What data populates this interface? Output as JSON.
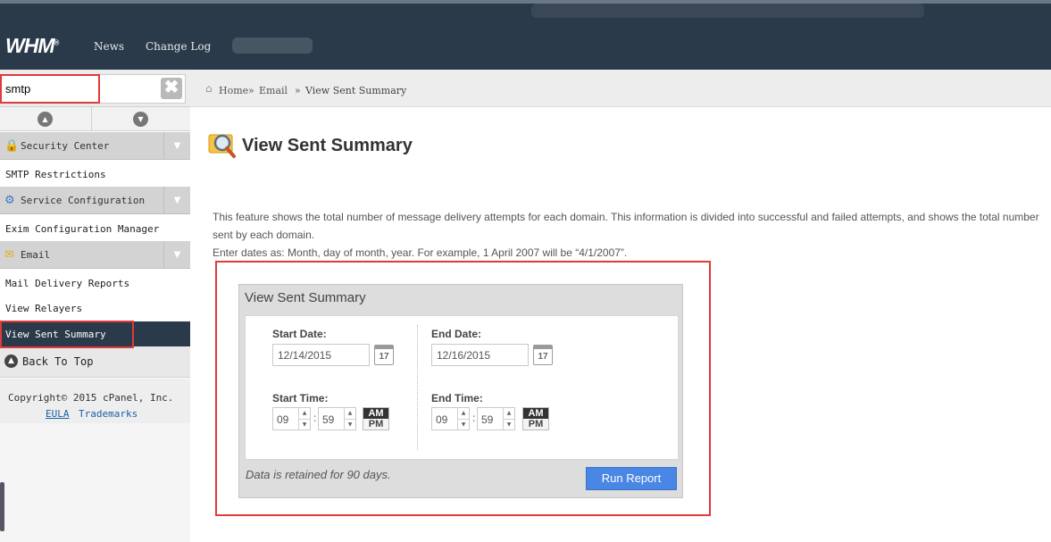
{
  "header": {
    "logo": "WHM",
    "logo_mark": "®",
    "nav": [
      "News",
      "Change Log"
    ]
  },
  "sidebar": {
    "search_value": "smtp",
    "clear_glyph": "✖",
    "up_glyph": "▲",
    "down_glyph": "▼",
    "categories": [
      {
        "label": "Security Center",
        "icon": "lock-icon",
        "items": [
          "SMTP Restrictions"
        ]
      },
      {
        "label": "Service Configuration",
        "icon": "gear-icon",
        "items": [
          "Exim Configuration Manager"
        ]
      },
      {
        "label": "Email",
        "icon": "envelope-icon",
        "items": [
          "Mail Delivery Reports",
          "View Relayers",
          "View Sent Summary"
        ]
      }
    ],
    "active_item": "View Sent Summary",
    "back_to_top": "Back To Top",
    "copyright": "Copyright© 2015 cPanel, Inc.",
    "links": [
      "EULA",
      "Trademarks"
    ]
  },
  "breadcrumb": {
    "items": [
      "Home",
      "Email",
      "View Sent Summary"
    ],
    "separator": "»"
  },
  "main": {
    "title": "View Sent Summary",
    "description_line1": "This feature shows the total number of message delivery attempts for each domain. This information is divided into successful and failed attempts, and shows the total number",
    "description_line2": "sent by each domain.",
    "date_hint": "Enter dates as: Month, day of month, year. For example, 1 April 2007 will be “4/1/2007”."
  },
  "form": {
    "panel_title": "View Sent Summary",
    "start_date_label": "Start Date:",
    "start_date": "12/14/2015",
    "end_date_label": "End Date:",
    "end_date": "12/16/2015",
    "calendar_day": "17",
    "start_time_label": "Start Time:",
    "end_time_label": "End Time:",
    "start_hour": "09",
    "start_minute": "59",
    "end_hour": "09",
    "end_minute": "59",
    "time_separator": ":",
    "am": "AM",
    "pm": "PM",
    "retention_note": "Data is retained for 90 days.",
    "run_button": "Run Report"
  },
  "colors": {
    "topbar": "#2b3a4a",
    "highlight": "#e03a3a",
    "run_button": "#4a86e4",
    "link": "#1b5ea8"
  }
}
